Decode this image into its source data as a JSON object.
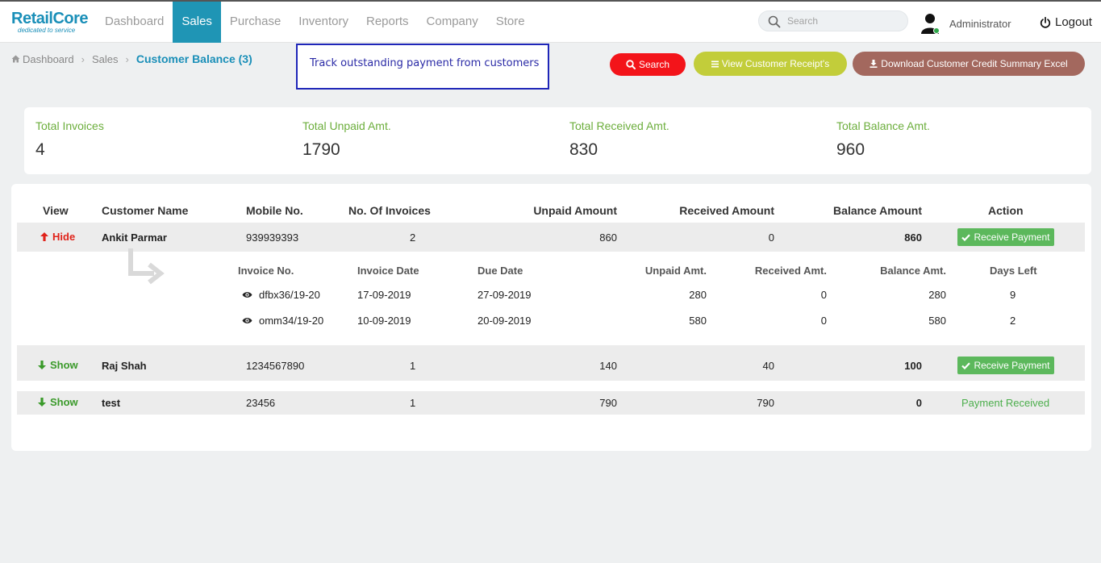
{
  "brand": {
    "name": "RetailCore",
    "tagline": "dedicated to service"
  },
  "nav": [
    "Dashboard",
    "Sales",
    "Purchase",
    "Inventory",
    "Reports",
    "Company",
    "Store"
  ],
  "search": {
    "placeholder": "Search"
  },
  "user": {
    "name": "Administrator",
    "logout": "Logout"
  },
  "breadcrumb": {
    "home": "Dashboard",
    "section": "Sales",
    "current": "Customer Balance (3)"
  },
  "callout": "Track outstanding payment from customers",
  "actions": {
    "search": "Search",
    "receipts": "View Customer Receipt's",
    "download": "Download Customer Credit Summary Excel"
  },
  "stats": [
    {
      "label": "Total Invoices",
      "value": "4"
    },
    {
      "label": "Total Unpaid Amt.",
      "value": "1790"
    },
    {
      "label": "Total Received Amt.",
      "value": "830"
    },
    {
      "label": "Total Balance Amt.",
      "value": "960"
    }
  ],
  "table": {
    "headers": [
      "View",
      "Customer Name",
      "Mobile No.",
      "No. Of Invoices",
      "Unpaid Amount",
      "Received Amount",
      "Balance Amount",
      "Action"
    ],
    "rows": [
      {
        "toggle": "Hide",
        "name": "Ankit Parmar",
        "mobile": "939939393",
        "invoices": "2",
        "unpaid": "860",
        "received": "0",
        "balance": "860",
        "action": "Receive Payment"
      },
      {
        "toggle": "Show",
        "name": "Raj Shah",
        "mobile": "1234567890",
        "invoices": "1",
        "unpaid": "140",
        "received": "40",
        "balance": "100",
        "action": "Receive Payment"
      },
      {
        "toggle": "Show",
        "name": "test",
        "mobile": "23456",
        "invoices": "1",
        "unpaid": "790",
        "received": "790",
        "balance": "0",
        "action": "Payment Received"
      }
    ],
    "detail": {
      "headers": [
        "Invoice No.",
        "Invoice Date",
        "Due Date",
        "Unpaid Amt.",
        "Received Amt.",
        "Balance Amt.",
        "Days Left"
      ],
      "rows": [
        {
          "invoice": "dfbx36/19-20",
          "date": "17-09-2019",
          "due": "27-09-2019",
          "unpaid": "280",
          "received": "0",
          "balance": "280",
          "days": "9"
        },
        {
          "invoice": "omm34/19-20",
          "date": "10-09-2019",
          "due": "20-09-2019",
          "unpaid": "580",
          "received": "0",
          "balance": "580",
          "days": "2"
        }
      ]
    }
  },
  "colors": {
    "accent": "#1f95b5",
    "search_btn": "#f3141a",
    "receipts_btn": "#c2cd3a",
    "download_btn": "#a3685e",
    "success": "#5cb85c"
  }
}
